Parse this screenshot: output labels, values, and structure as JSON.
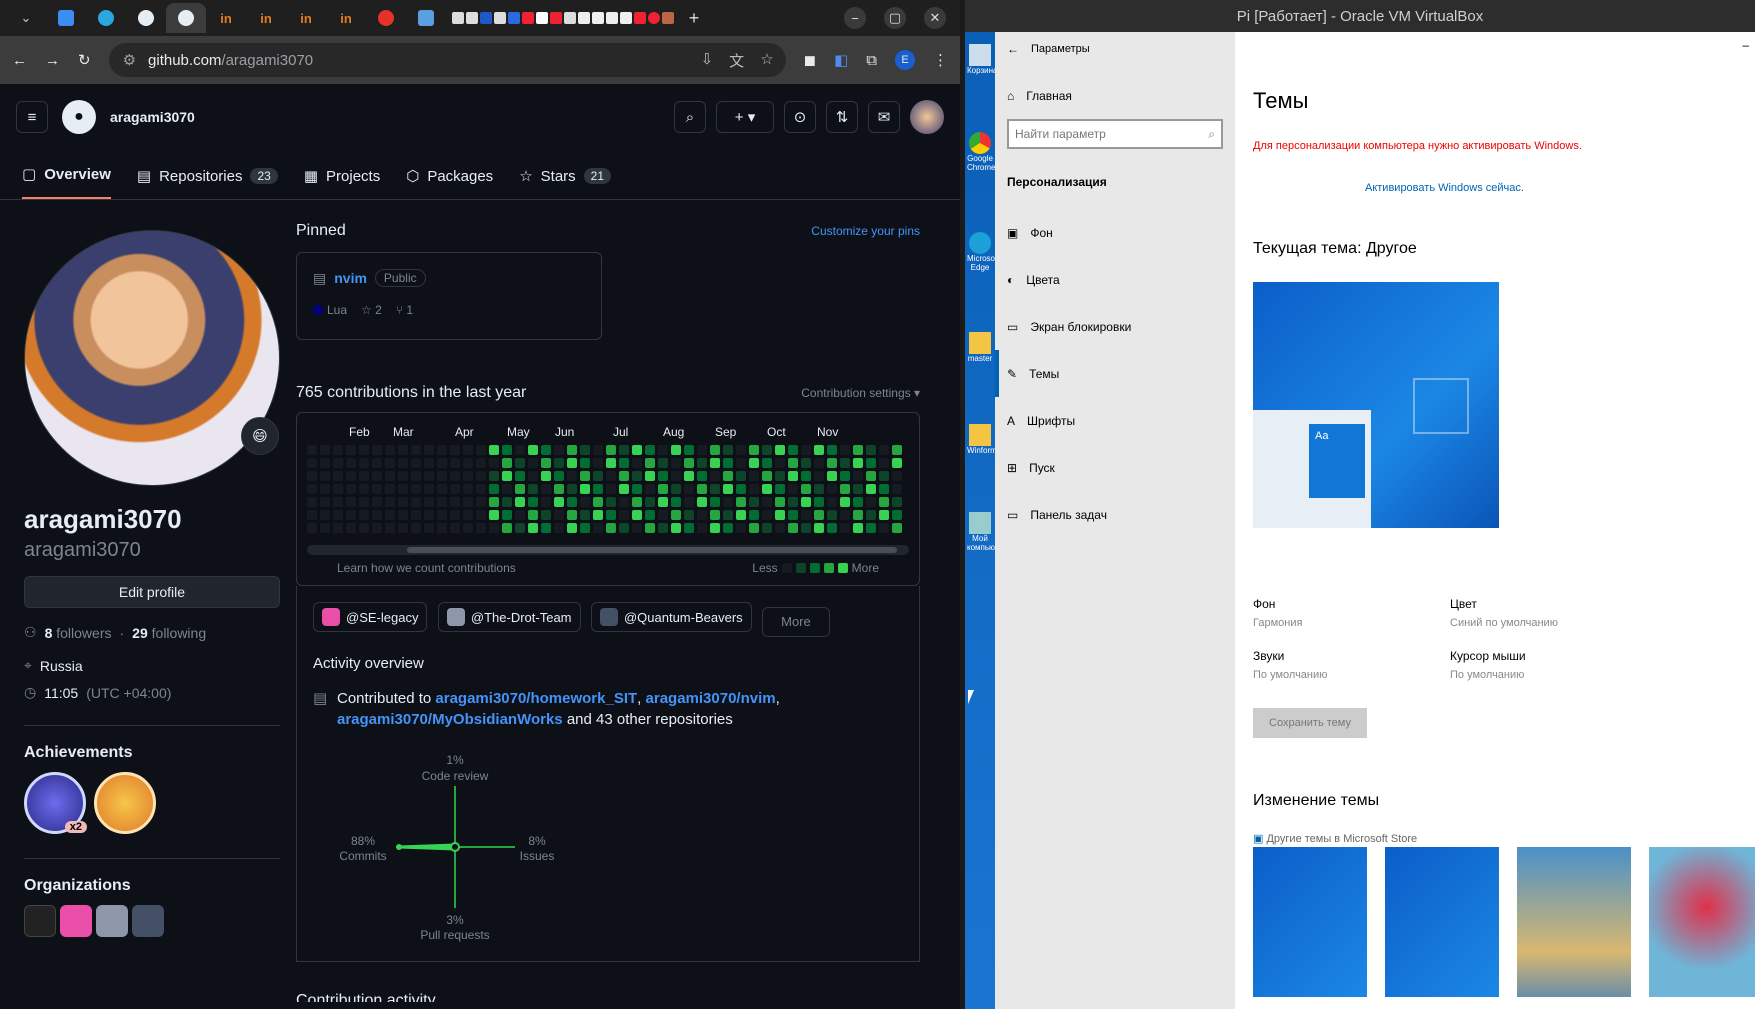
{
  "browser": {
    "url_host": "github.com",
    "url_path": "/aragami3070",
    "tab_icons": [
      "browser-tabs-icon",
      "telegram-icon",
      "github-icon",
      "github-icon",
      "habr-icon",
      "habr-icon",
      "habr-icon",
      "habr-icon",
      "ask-icon",
      "ext-icon"
    ],
    "new_tab": "+",
    "win_min": "−",
    "win_max": "▢",
    "win_close": "✕",
    "profile_letter": "E"
  },
  "github": {
    "username_header": "aragami3070",
    "nav": [
      {
        "label": "Overview"
      },
      {
        "label": "Repositories",
        "count": "23"
      },
      {
        "label": "Projects"
      },
      {
        "label": "Packages"
      },
      {
        "label": "Stars",
        "count": "21"
      }
    ],
    "profile": {
      "name": "aragami3070",
      "login": "aragami3070",
      "status_emoji": "😄",
      "edit_label": "Edit profile",
      "followers": "8",
      "followers_label": "followers",
      "following": "29",
      "following_label": "following",
      "separator": "·",
      "location": "Russia",
      "time": "11:05",
      "tz": "(UTC +04:00)",
      "achievements_title": "Achievements",
      "achievement_badge": "x2",
      "orgs_title": "Organizations"
    },
    "pinned": {
      "title": "Pinned",
      "customize": "Customize your pins",
      "repo": "nvim",
      "visibility": "Public",
      "language": "Lua",
      "language_color": "#000080",
      "stars": "2",
      "forks": "1"
    },
    "contrib": {
      "title": "765 contributions in the last year",
      "settings": "Contribution settings",
      "months": [
        "Feb",
        "Mar",
        "Apr",
        "May",
        "Jun",
        "Jul",
        "Aug",
        "Sep",
        "Oct",
        "Nov"
      ],
      "learn": "Learn how we count contributions",
      "less": "Less",
      "more": "More",
      "colors": [
        "#161b22",
        "#0e4429",
        "#006d32",
        "#26a641",
        "#39d353"
      ]
    },
    "orgs_buttons": [
      "@SE-legacy",
      "@The-Drot-Team",
      "@Quantum-Beavers"
    ],
    "more_label": "More",
    "activity": {
      "title": "Activity overview",
      "contributed_to": "Contributed to",
      "repo1": "aragami3070/homework_SIT",
      "repo2": "aragami3070/nvim",
      "repo3": "aragami3070/MyObsidianWorks",
      "comma": ",",
      "and_more": "and 43 other repositories",
      "code_review_pct": "1%",
      "code_review": "Code review",
      "commits_pct": "88%",
      "commits": "Commits",
      "issues_pct": "8%",
      "issues": "Issues",
      "pr_pct": "3%",
      "pr": "Pull requests"
    },
    "next_section": "Contribution activity"
  },
  "vbox": {
    "title": "Pi [Работает] - Oracle VM VirtualBox",
    "desktop_icons": [
      "Корзина",
      "Google Chrome",
      "Microsoft Edge",
      "master",
      "Winform",
      "Мой компьютер"
    ],
    "settings": {
      "back_title": "Параметры",
      "home": "Главная",
      "search_placeholder": "Найти параметр",
      "section": "Персонализация",
      "items": [
        "Фон",
        "Цвета",
        "Экран блокировки",
        "Темы",
        "Шрифты",
        "Пуск",
        "Панель задач"
      ],
      "page_title": "Темы",
      "warning": "Для персонализации компьютера нужно активировать Windows.",
      "activate": "Активировать Windows сейчас.",
      "current_theme": "Текущая тема: Другое",
      "bg_label": "Фон",
      "bg_value": "Гармония",
      "color_label": "Цвет",
      "color_value": "Синий по умолчанию",
      "sound_label": "Звуки",
      "sound_value": "По умолчанию",
      "cursor_label": "Курсор мыши",
      "cursor_value": "По умолчанию",
      "save_theme": "Сохранить тему",
      "change_theme": "Изменение темы",
      "store_link": "Другие темы в Microsoft Store",
      "tile_text": "Aa",
      "close": "–"
    }
  }
}
